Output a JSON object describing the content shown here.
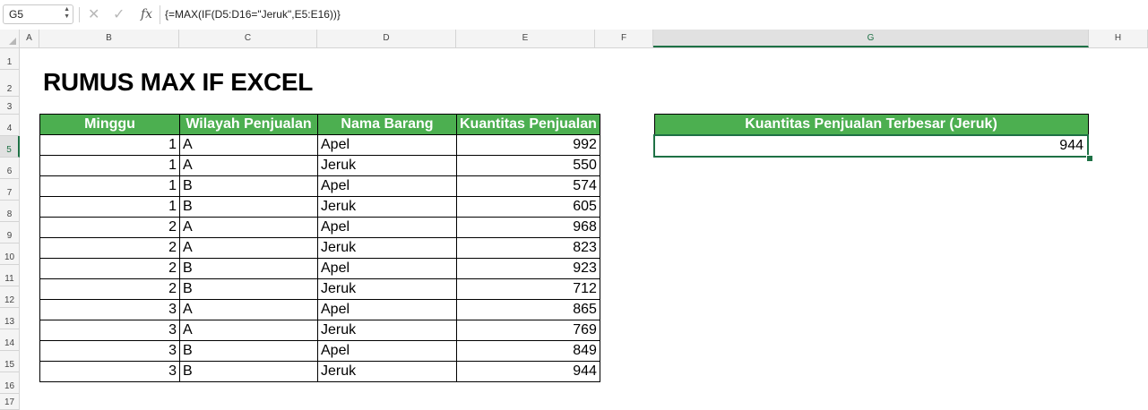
{
  "formula_bar": {
    "name_box": "G5",
    "cancel_icon": "✕",
    "enter_icon": "✓",
    "fx_label": "fx",
    "formula": "{=MAX(IF(D5:D16=\"Jeruk\",E5:E16))}"
  },
  "columns": [
    "A",
    "B",
    "C",
    "D",
    "E",
    "F",
    "G",
    "H"
  ],
  "rows": [
    "1",
    "2",
    "3",
    "4",
    "5",
    "6",
    "7",
    "8",
    "9",
    "10",
    "11",
    "12",
    "13",
    "14",
    "15",
    "16",
    "17"
  ],
  "title": "RUMUS MAX IF EXCEL",
  "table": {
    "headers": [
      "Minggu",
      "Wilayah Penjualan",
      "Nama Barang",
      "Kuantitas Penjualan"
    ],
    "rows": [
      [
        "1",
        "A",
        "Apel",
        "992"
      ],
      [
        "1",
        "A",
        "Jeruk",
        "550"
      ],
      [
        "1",
        "B",
        "Apel",
        "574"
      ],
      [
        "1",
        "B",
        "Jeruk",
        "605"
      ],
      [
        "2",
        "A",
        "Apel",
        "968"
      ],
      [
        "2",
        "A",
        "Jeruk",
        "823"
      ],
      [
        "2",
        "B",
        "Apel",
        "923"
      ],
      [
        "2",
        "B",
        "Jeruk",
        "712"
      ],
      [
        "3",
        "A",
        "Apel",
        "865"
      ],
      [
        "3",
        "A",
        "Jeruk",
        "769"
      ],
      [
        "3",
        "B",
        "Apel",
        "849"
      ],
      [
        "3",
        "B",
        "Jeruk",
        "944"
      ]
    ]
  },
  "result": {
    "header": "Kuantitas Penjualan Terbesar (Jeruk)",
    "value": "944"
  },
  "colors": {
    "header_green": "#4caf50",
    "selection_green": "#1e7145"
  }
}
